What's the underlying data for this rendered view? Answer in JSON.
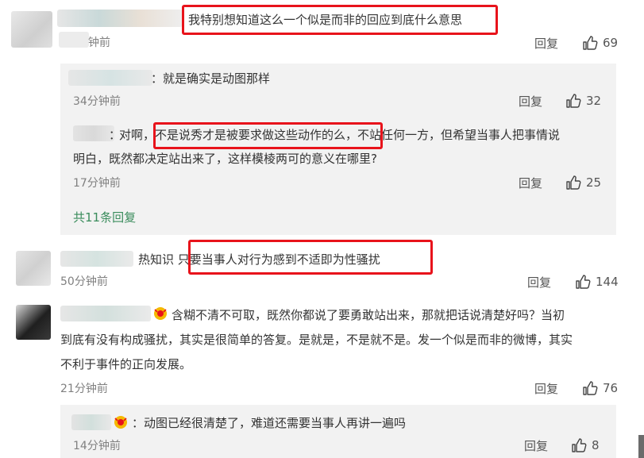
{
  "comments": [
    {
      "text": "我特别想知道这么一个似是而非的回应到底什么意思",
      "time": "钟前",
      "reply_label": "回复",
      "likes": "69"
    },
    {
      "text": "热知识 只要当事人对行为感到不适即为性骚扰",
      "time": "50分钟前",
      "reply_label": "回复",
      "likes": "144"
    },
    {
      "text_line1": "含糊不清不可取，既然你都说了要勇敢站出来，那就把话说清楚好吗？当初",
      "text_line2": "到底有没有构成骚扰，其实是很简单的答复。是就是，不是就不是。发一个似是而非的微博，其实",
      "text_line3": "不利于事件的正向发展。",
      "time": "21分钟前",
      "reply_label": "回复",
      "likes": "76"
    }
  ],
  "replies_1": [
    {
      "text": "：就是确实是动图那样",
      "time": "34分钟前",
      "reply_label": "回复",
      "likes": "32"
    },
    {
      "text_line1": "对啊，不是说秀才是被要求做这些动作的么，不站任何一方，但希望当事人把事情说",
      "text_line2": "明白，既然都决定站出来了，这样模棱两可的意义在哪里?",
      "colon": "：",
      "time": "17分钟前",
      "reply_label": "回复",
      "likes": "25"
    }
  ],
  "more_replies": "共11条回复",
  "replies_3": [
    {
      "text": "：动图已经很清楚了，难道还需要当事人再讲一遍吗",
      "time": "14分钟前",
      "reply_label": "回复",
      "likes": "8"
    }
  ],
  "colors": {
    "highlight": "#e8131b",
    "link_green": "#3a8c5c",
    "panel_bg": "#f2f2f2"
  }
}
